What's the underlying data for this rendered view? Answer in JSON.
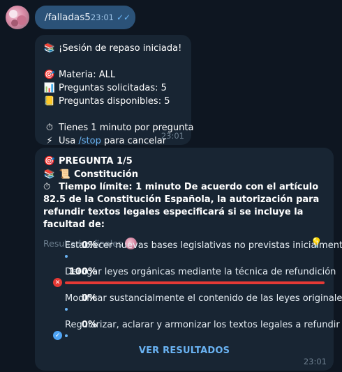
{
  "outgoing": {
    "command": "/falladas5",
    "time": "23:01"
  },
  "message1": {
    "title": "¡Sesión de repaso iniciada!",
    "materia": "Materia: ALL",
    "solicitadas": "Preguntas solicitadas: 5",
    "disponibles": "Preguntas disponibles: 5",
    "tiempo": "Tienes 1 minuto por pregunta",
    "cancel_prefix": "Usa ",
    "cancel_cmd": "/stop",
    "cancel_suffix": " para cancelar",
    "time": "23:01",
    "icons": [
      "books-icon",
      "dart-icon",
      "bar-chart-icon",
      "ledger-icon",
      "stopwatch-icon",
      "lightning-icon"
    ]
  },
  "poll": {
    "heading": "PREGUNTA 1/5",
    "topic": "Constitución",
    "question": "Tiempo límite: 1 minuto  De acuerdo con el artículo 82.5 de la Constitución Española, la autorización para refundir textos legales especificará si se incluye la facultad de:",
    "results_label": "Resultados finales",
    "options": [
      {
        "percent": "0%",
        "text": "Establecer nuevas bases legislativas no previstas inicialmente",
        "value": 0,
        "mark": "none"
      },
      {
        "percent": "100%",
        "text": "Derogar leyes orgánicas mediante la técnica de refundición",
        "value": 100,
        "mark": "wrong"
      },
      {
        "percent": "0%",
        "text": "Modificar sustancialmente el contenido de las leyes originales",
        "value": 0,
        "mark": "none"
      },
      {
        "percent": "0%",
        "text": "Regularizar, aclarar y armonizar los textos legales a refundir",
        "value": 0,
        "mark": "right"
      }
    ],
    "button": "VER RESULTADOS",
    "time": "23:01",
    "colors": {
      "wrong": "#e53935",
      "right": "#4ea4f5",
      "bar": "#6ab3f3"
    }
  }
}
